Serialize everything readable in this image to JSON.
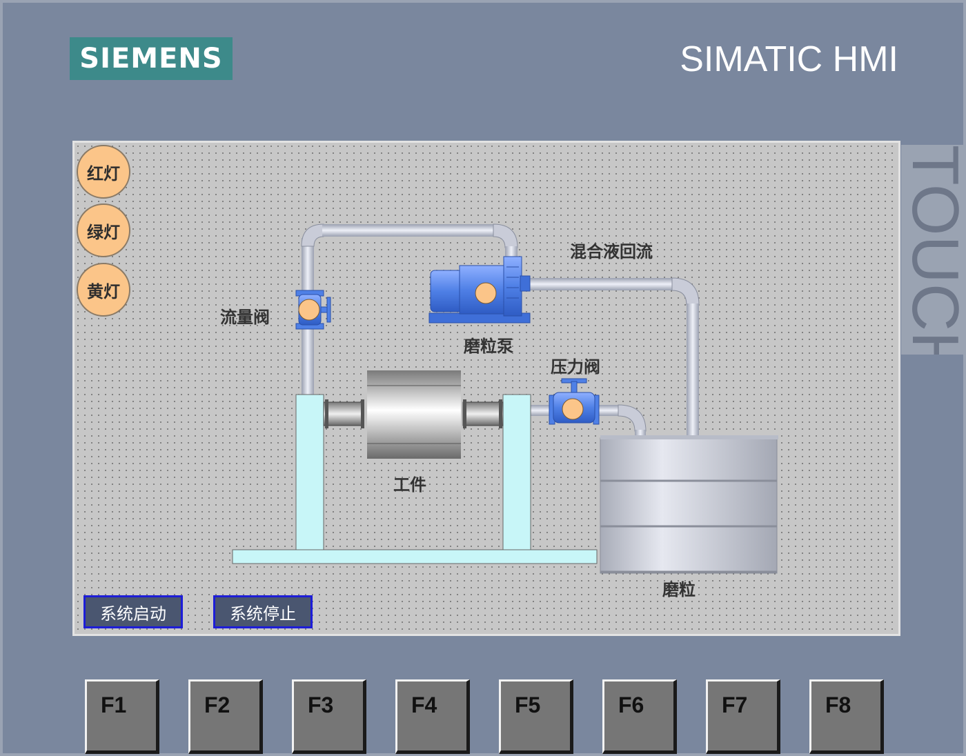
{
  "header": {
    "brand": "SIEMENS",
    "product": "SIMATIC HMI",
    "side_label": "TOUCH"
  },
  "lamps": [
    {
      "label": "红灯"
    },
    {
      "label": "绿灯"
    },
    {
      "label": "黄灯"
    }
  ],
  "process": {
    "flow_valve_label": "流量阀",
    "pump_label": "磨粒泵",
    "return_label": "混合液回流",
    "pressure_valve_label": "压力阀",
    "workpiece_label": "工件",
    "tank_label": "磨粒"
  },
  "controls": {
    "start_label": "系统启动",
    "stop_label": "系统停止"
  },
  "function_keys": [
    "F1",
    "F2",
    "F3",
    "F4",
    "F5",
    "F6",
    "F7",
    "F8"
  ],
  "colors": {
    "lamp_off": "#fbc589",
    "button_border": "#1d1dd8",
    "fixture": "#c8f6f8",
    "pipe": "#d2d6e4",
    "device_blue": "#4f80e6"
  }
}
